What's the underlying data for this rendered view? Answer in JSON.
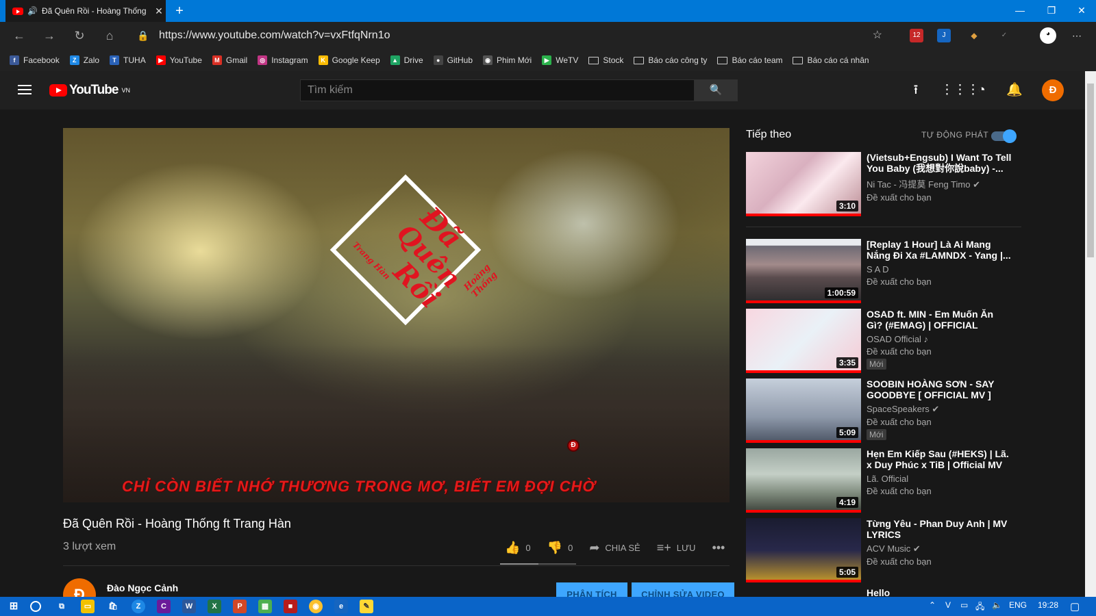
{
  "browser": {
    "tab_title": "Đã Quên Rồi - Hoàng Thống",
    "tab_speaker": "🔊",
    "tab_close": "✕",
    "new_tab": "+",
    "url": "https://www.youtube.com/watch?v=vxFtfqNrn1o",
    "ext_badge": "12"
  },
  "bookmarks": [
    {
      "label": "Facebook",
      "icon": "facebook-icon",
      "color": "#3b5998",
      "glyph": "f"
    },
    {
      "label": "Zalo",
      "icon": "zalo-icon",
      "color": "#1e88e5",
      "glyph": "Z"
    },
    {
      "label": "TUHA",
      "icon": "tuha-icon",
      "color": "#2a62b8",
      "glyph": "T"
    },
    {
      "label": "YouTube",
      "icon": "youtube-icon",
      "color": "#ff0000",
      "glyph": "▶"
    },
    {
      "label": "Gmail",
      "icon": "gmail-icon",
      "color": "#d93025",
      "glyph": "M"
    },
    {
      "label": "Instagram",
      "icon": "instagram-icon",
      "color": "#c13584",
      "glyph": "◎"
    },
    {
      "label": "Google Keep",
      "icon": "keep-icon",
      "color": "#fbbc04",
      "glyph": "K"
    },
    {
      "label": "Drive",
      "icon": "drive-icon",
      "color": "#1fa463",
      "glyph": "▲"
    },
    {
      "label": "GitHub",
      "icon": "github-icon",
      "color": "#444444",
      "glyph": "●"
    },
    {
      "label": "Phim Mới",
      "icon": "phimmoi-icon",
      "color": "#555555",
      "glyph": "◉"
    },
    {
      "label": "WeTV",
      "icon": "wetv-icon",
      "color": "#2bb24c",
      "glyph": "▶"
    },
    {
      "label": "Stock",
      "icon": "folder-icon",
      "folder": true
    },
    {
      "label": "Báo cáo công ty",
      "icon": "folder-icon",
      "folder": true
    },
    {
      "label": "Báo cáo team",
      "icon": "folder-icon",
      "folder": true
    },
    {
      "label": "Báo cáo cá nhân",
      "icon": "folder-icon",
      "folder": true
    }
  ],
  "youtube": {
    "logo": "YouTube",
    "region": "VN",
    "search_placeholder": "Tìm kiếm",
    "avatar_letter": "Đ"
  },
  "video": {
    "calligraphy_1": "Đã",
    "calligraphy_2": "Quên",
    "calligraphy_3": "Rồi",
    "signature_1": "Hoàng Thống",
    "signature_2": "Trang Hàn",
    "lyrics": "CHỈ CÒN BIẾT NHỚ THƯƠNG TRONG MƠ, BIẾT EM ĐỢI CHỜ",
    "watermark": "Đ",
    "title": "Đã Quên Rồi - Hoàng Thống ft Trang Hàn",
    "views": "3 lượt xem",
    "likes": "0",
    "dislikes": "0",
    "like_ratio": 0.5,
    "share_label": "CHIA SẺ",
    "save_label": "LƯU",
    "more": "•••",
    "channel_name": "Đào Ngọc Cảnh",
    "channel_avatar": "Đ",
    "analytics_label": "PHÂN TÍCH",
    "edit_label": "CHỈNH SỬA VIDEO"
  },
  "sidebar": {
    "up_next": "Tiếp theo",
    "autoplay": "TỰ ĐỘNG PHÁT",
    "autoplay_on": true,
    "items": [
      {
        "title": "(Vietsub+Engsub) I Want To Tell You Baby (我想對你說baby) -...",
        "channel": "Ni Tac - 冯提莫 Feng Timo ✔",
        "rec": "Đề xuất cho bạn",
        "duration": "3:10",
        "badge": ""
      },
      {
        "title": "[Replay 1 Hour] Là Ai Mang Nắng Đi Xa #LAMNDX - Yang |...",
        "channel": "S A D",
        "rec": "Đề xuất cho bạn",
        "duration": "1:00:59",
        "badge": ""
      },
      {
        "title": "OSAD ft. MIN - Em Muốn Ăn Gì? (#EMAG) | OFFICIAL MUSIC...",
        "channel": "OSAD Official ♪",
        "rec": "Đề xuất cho bạn",
        "duration": "3:35",
        "badge": "Mới"
      },
      {
        "title": "SOOBIN HOÀNG SƠN - SAY GOODBYE [ OFFICIAL MV ]",
        "channel": "SpaceSpeakers ✔",
        "rec": "Đề xuất cho bạn",
        "duration": "5:09",
        "badge": "Mới"
      },
      {
        "title": "Hẹn Em Kiếp Sau (#HEKS) | Lã. x Duy Phúc x TiB | Official MV",
        "channel": "Lã. Official",
        "rec": "Đề xuất cho bạn",
        "duration": "4:19",
        "badge": ""
      },
      {
        "title": "Từng Yêu - Phan Duy Anh | MV LYRICS",
        "channel": "ACV Music ✔",
        "rec": "Đề xuất cho bạn",
        "duration": "5:05",
        "badge": ""
      }
    ],
    "next_title": "Hello"
  },
  "taskbar": {
    "lang": "ENG",
    "time": "19:28"
  }
}
